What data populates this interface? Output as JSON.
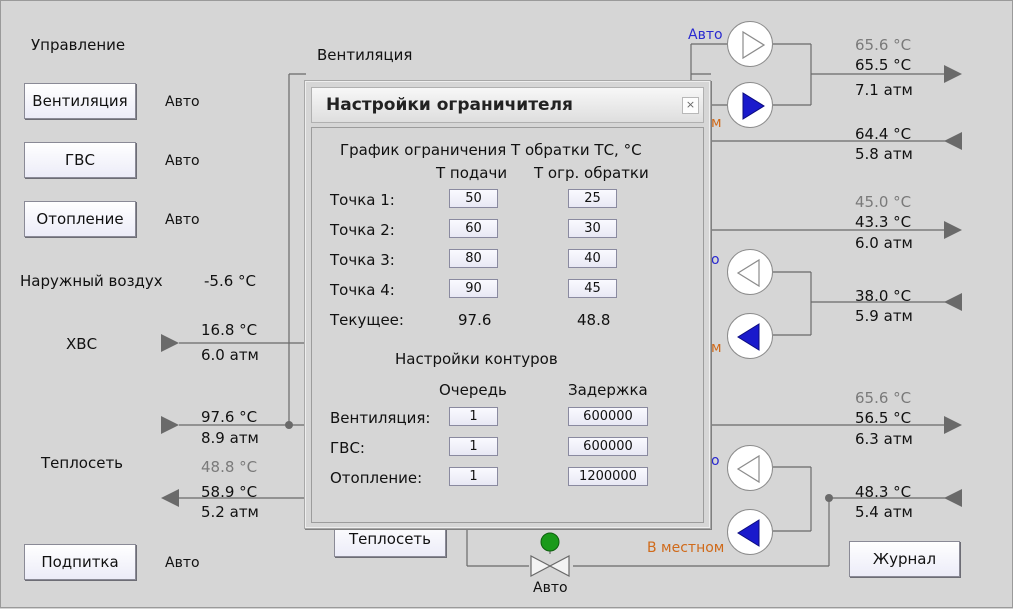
{
  "control": {
    "title": "Управление",
    "buttons": [
      {
        "label": "Вентиляция",
        "mode": "Авто"
      },
      {
        "label": "ГВС",
        "mode": "Авто"
      },
      {
        "label": "Отопление",
        "mode": "Авто"
      }
    ],
    "makeup_button": "Подпитка",
    "makeup_mode": "Авто"
  },
  "outdoor": {
    "label": "Наружный воздух",
    "temp": "-5.6 °C"
  },
  "cold_water": {
    "label": "ХВС",
    "temp": "16.8 °C",
    "pressure": "6.0 атм"
  },
  "heat_net": {
    "label": "Теплосеть",
    "supply_temp": "97.6 °C",
    "supply_pressure": "8.9 атм",
    "return_limit": "48.8 °C",
    "return_temp": "58.9 °C",
    "return_pressure": "5.2 атм",
    "button": "Теплосеть"
  },
  "ventilation_label": "Вентиляция",
  "pumps": {
    "vent_auto": "Авто",
    "vent_local": "м",
    "dhw_auto": "о",
    "dhw_local": "м",
    "heat_auto": "о",
    "heat_local": "В местном"
  },
  "circuits": {
    "vent_supply_set": "65.6 °C",
    "vent_supply_temp": "65.5 °C",
    "vent_supply_pressure": "7.1 атм",
    "vent_return_temp": "64.4 °C",
    "vent_return_pressure": "5.8 атм",
    "dhw_supply_set": "45.0 °C",
    "dhw_supply_temp": "43.3 °C",
    "dhw_supply_pressure": "6.0 атм",
    "dhw_return_temp": "38.0 °C",
    "dhw_return_pressure": "5.9 атм",
    "heat_supply_set": "65.6 °C",
    "heat_supply_temp": "56.5 °C",
    "heat_supply_pressure": "6.3 атм",
    "heat_return_temp": "48.3 °C",
    "heat_return_pressure": "5.4 атм"
  },
  "valve_mode": "Авто",
  "journal_button": "Журнал",
  "dialog": {
    "title": "Настройки ограничителя",
    "close": "×",
    "chart_title": "График ограничения Т обратки ТС, °C",
    "col_supply": "Т подачи",
    "col_limit": "Т огр. обратки",
    "points": [
      {
        "label": "Точка 1:",
        "supply": "50",
        "limit": "25"
      },
      {
        "label": "Точка 2:",
        "supply": "60",
        "limit": "30"
      },
      {
        "label": "Точка 3:",
        "supply": "80",
        "limit": "40"
      },
      {
        "label": "Точка 4:",
        "supply": "90",
        "limit": "45"
      }
    ],
    "current_label": "Текущее:",
    "current_supply": "97.6",
    "current_limit": "48.8",
    "circuits_title": "Настройки контуров",
    "col_queue": "Очередь",
    "col_delay": "Задержка",
    "circuits": [
      {
        "label": "Вентиляция:",
        "queue": "1",
        "delay": "600000"
      },
      {
        "label": "ГВС:",
        "queue": "1",
        "delay": "600000"
      },
      {
        "label": "Отопление:",
        "queue": "1",
        "delay": "1200000"
      }
    ]
  }
}
